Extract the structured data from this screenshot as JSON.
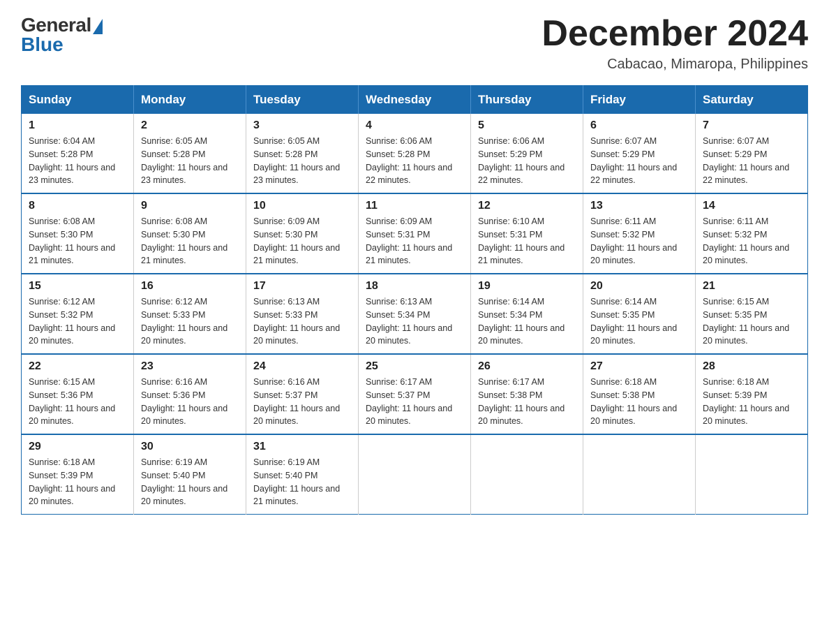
{
  "header": {
    "logo_general": "General",
    "logo_blue": "Blue",
    "month_title": "December 2024",
    "location": "Cabacao, Mimaropa, Philippines"
  },
  "days_of_week": [
    "Sunday",
    "Monday",
    "Tuesday",
    "Wednesday",
    "Thursday",
    "Friday",
    "Saturday"
  ],
  "weeks": [
    [
      {
        "day": "1",
        "sunrise": "6:04 AM",
        "sunset": "5:28 PM",
        "daylight": "11 hours and 23 minutes."
      },
      {
        "day": "2",
        "sunrise": "6:05 AM",
        "sunset": "5:28 PM",
        "daylight": "11 hours and 23 minutes."
      },
      {
        "day": "3",
        "sunrise": "6:05 AM",
        "sunset": "5:28 PM",
        "daylight": "11 hours and 23 minutes."
      },
      {
        "day": "4",
        "sunrise": "6:06 AM",
        "sunset": "5:28 PM",
        "daylight": "11 hours and 22 minutes."
      },
      {
        "day": "5",
        "sunrise": "6:06 AM",
        "sunset": "5:29 PM",
        "daylight": "11 hours and 22 minutes."
      },
      {
        "day": "6",
        "sunrise": "6:07 AM",
        "sunset": "5:29 PM",
        "daylight": "11 hours and 22 minutes."
      },
      {
        "day": "7",
        "sunrise": "6:07 AM",
        "sunset": "5:29 PM",
        "daylight": "11 hours and 22 minutes."
      }
    ],
    [
      {
        "day": "8",
        "sunrise": "6:08 AM",
        "sunset": "5:30 PM",
        "daylight": "11 hours and 21 minutes."
      },
      {
        "day": "9",
        "sunrise": "6:08 AM",
        "sunset": "5:30 PM",
        "daylight": "11 hours and 21 minutes."
      },
      {
        "day": "10",
        "sunrise": "6:09 AM",
        "sunset": "5:30 PM",
        "daylight": "11 hours and 21 minutes."
      },
      {
        "day": "11",
        "sunrise": "6:09 AM",
        "sunset": "5:31 PM",
        "daylight": "11 hours and 21 minutes."
      },
      {
        "day": "12",
        "sunrise": "6:10 AM",
        "sunset": "5:31 PM",
        "daylight": "11 hours and 21 minutes."
      },
      {
        "day": "13",
        "sunrise": "6:11 AM",
        "sunset": "5:32 PM",
        "daylight": "11 hours and 20 minutes."
      },
      {
        "day": "14",
        "sunrise": "6:11 AM",
        "sunset": "5:32 PM",
        "daylight": "11 hours and 20 minutes."
      }
    ],
    [
      {
        "day": "15",
        "sunrise": "6:12 AM",
        "sunset": "5:32 PM",
        "daylight": "11 hours and 20 minutes."
      },
      {
        "day": "16",
        "sunrise": "6:12 AM",
        "sunset": "5:33 PM",
        "daylight": "11 hours and 20 minutes."
      },
      {
        "day": "17",
        "sunrise": "6:13 AM",
        "sunset": "5:33 PM",
        "daylight": "11 hours and 20 minutes."
      },
      {
        "day": "18",
        "sunrise": "6:13 AM",
        "sunset": "5:34 PM",
        "daylight": "11 hours and 20 minutes."
      },
      {
        "day": "19",
        "sunrise": "6:14 AM",
        "sunset": "5:34 PM",
        "daylight": "11 hours and 20 minutes."
      },
      {
        "day": "20",
        "sunrise": "6:14 AM",
        "sunset": "5:35 PM",
        "daylight": "11 hours and 20 minutes."
      },
      {
        "day": "21",
        "sunrise": "6:15 AM",
        "sunset": "5:35 PM",
        "daylight": "11 hours and 20 minutes."
      }
    ],
    [
      {
        "day": "22",
        "sunrise": "6:15 AM",
        "sunset": "5:36 PM",
        "daylight": "11 hours and 20 minutes."
      },
      {
        "day": "23",
        "sunrise": "6:16 AM",
        "sunset": "5:36 PM",
        "daylight": "11 hours and 20 minutes."
      },
      {
        "day": "24",
        "sunrise": "6:16 AM",
        "sunset": "5:37 PM",
        "daylight": "11 hours and 20 minutes."
      },
      {
        "day": "25",
        "sunrise": "6:17 AM",
        "sunset": "5:37 PM",
        "daylight": "11 hours and 20 minutes."
      },
      {
        "day": "26",
        "sunrise": "6:17 AM",
        "sunset": "5:38 PM",
        "daylight": "11 hours and 20 minutes."
      },
      {
        "day": "27",
        "sunrise": "6:18 AM",
        "sunset": "5:38 PM",
        "daylight": "11 hours and 20 minutes."
      },
      {
        "day": "28",
        "sunrise": "6:18 AM",
        "sunset": "5:39 PM",
        "daylight": "11 hours and 20 minutes."
      }
    ],
    [
      {
        "day": "29",
        "sunrise": "6:18 AM",
        "sunset": "5:39 PM",
        "daylight": "11 hours and 20 minutes."
      },
      {
        "day": "30",
        "sunrise": "6:19 AM",
        "sunset": "5:40 PM",
        "daylight": "11 hours and 20 minutes."
      },
      {
        "day": "31",
        "sunrise": "6:19 AM",
        "sunset": "5:40 PM",
        "daylight": "11 hours and 21 minutes."
      },
      null,
      null,
      null,
      null
    ]
  ],
  "labels": {
    "sunrise_prefix": "Sunrise: ",
    "sunset_prefix": "Sunset: ",
    "daylight_prefix": "Daylight: "
  }
}
